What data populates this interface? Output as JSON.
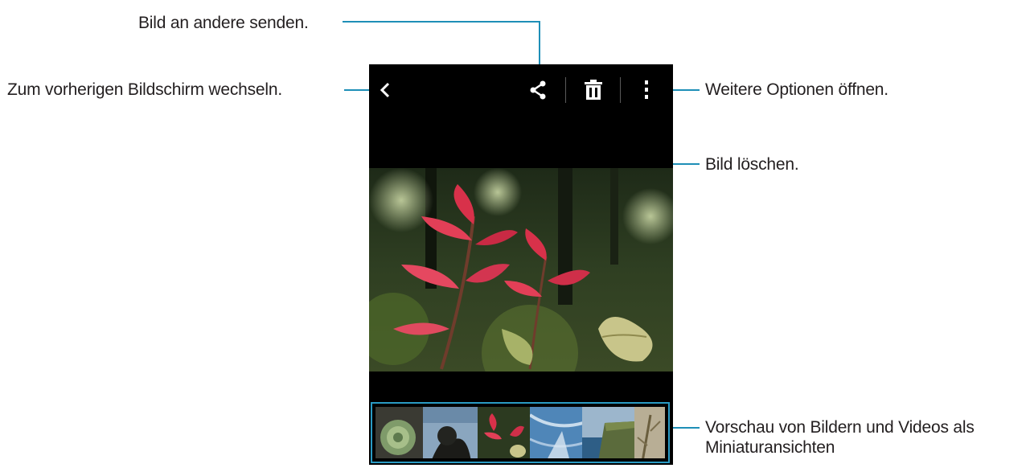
{
  "callouts": {
    "share": "Bild an andere senden.",
    "back": "Zum vorherigen Bildschirm wechseln.",
    "more": "Weitere Optionen öffnen.",
    "delete": "Bild löschen.",
    "preview_line1": "Vorschau von Bildern und Videos als",
    "preview_line2": "Miniaturansichten"
  },
  "icons": {
    "back": "chevron-left-icon",
    "share": "share-icon",
    "delete": "trash-icon",
    "more": "more-vertical-icon"
  },
  "colors": {
    "callout_line": "#1e8fb7",
    "thumbstrip_border": "#2a9bc4",
    "screen_background": "#000000"
  },
  "thumbnails": [
    {
      "name": "succulent"
    },
    {
      "name": "tree-silhouette"
    },
    {
      "name": "red-leaves",
      "selected": true
    },
    {
      "name": "aerial-sea"
    },
    {
      "name": "coastal-cliff"
    },
    {
      "name": "dry-plant"
    }
  ]
}
